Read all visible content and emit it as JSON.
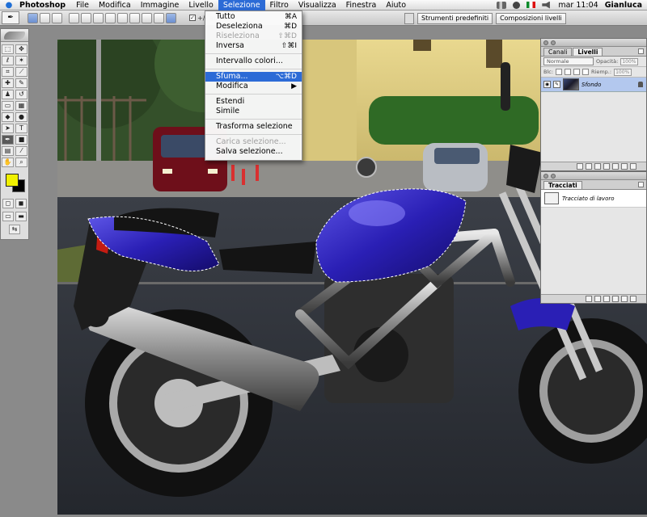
{
  "menubar": {
    "app": "Photoshop",
    "items": [
      "File",
      "Modifica",
      "Immagine",
      "Livello",
      "Selezione",
      "Filtro",
      "Visualizza",
      "Finestra",
      "Aiuto"
    ],
    "active_index": 4,
    "clock": "mar 11:04",
    "user": "Gianluca"
  },
  "options_bar": {
    "tool_icon": "pen-icon",
    "checkbox_label": "+/- au",
    "palette_well_tabs": [
      "Strumenti predefiniti",
      "Composizioni livelli"
    ]
  },
  "selection_menu": {
    "items": [
      {
        "label": "Tutto",
        "shortcut": "⌘A",
        "disabled": false
      },
      {
        "label": "Deseleziona",
        "shortcut": "⌘D",
        "disabled": false
      },
      {
        "label": "Riseleziona",
        "shortcut": "⇧⌘D",
        "disabled": true
      },
      {
        "label": "Inversa",
        "shortcut": "⇧⌘I",
        "disabled": false
      },
      {
        "label": "Intervallo colori...",
        "shortcut": "",
        "disabled": false
      },
      {
        "label": "Sfuma...",
        "shortcut": "⌥⌘D",
        "disabled": false,
        "highlighted": true
      },
      {
        "label": "Modifica",
        "shortcut": "▶",
        "disabled": false
      },
      {
        "label": "Estendi",
        "shortcut": "",
        "disabled": false
      },
      {
        "label": "Simile",
        "shortcut": "",
        "disabled": false
      },
      {
        "label": "Trasforma selezione",
        "shortcut": "",
        "disabled": false
      },
      {
        "label": "Carica selezione...",
        "shortcut": "",
        "disabled": true
      },
      {
        "label": "Salva selezione...",
        "shortcut": "",
        "disabled": false
      }
    ]
  },
  "layers_palette": {
    "tabs": [
      "Canali",
      "Livelli"
    ],
    "active_tab": "Livelli",
    "blend_mode": "Normale",
    "opacity_label": "Opacità:",
    "opacity_value": "100%",
    "lock_label": "Blc:",
    "fill_label": "Riemp.:",
    "fill_value": "100%",
    "layer_name": "Sfondo"
  },
  "paths_palette": {
    "tab": "Tracciati",
    "path_name": "Tracciato di lavoro"
  },
  "colors": {
    "foreground": "#f0f000",
    "background": "#000000",
    "accent": "#2c6bd6",
    "motorcycle_tank": "#2a1fb5"
  }
}
